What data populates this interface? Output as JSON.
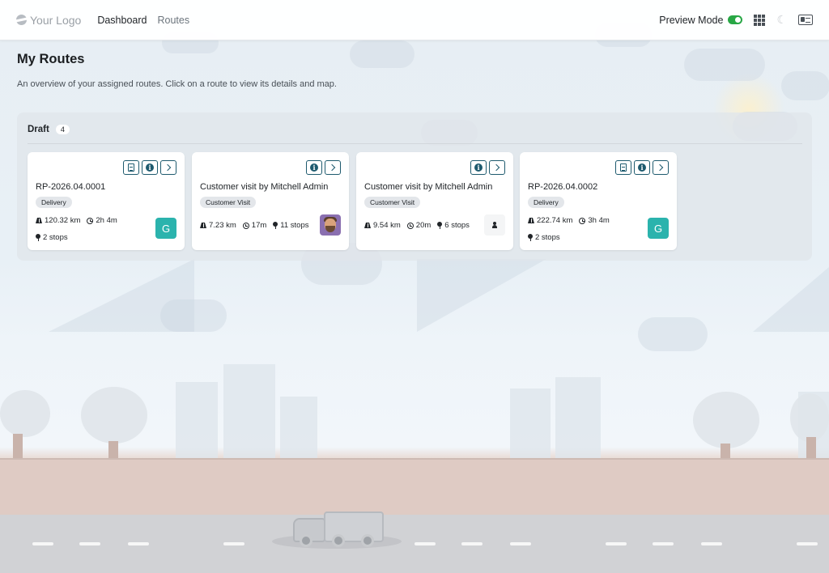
{
  "navbar": {
    "logo_text": "Your Logo",
    "links": [
      "Dashboard",
      "Routes"
    ],
    "preview_label": "Preview Mode",
    "preview_on": true
  },
  "page": {
    "title": "My Routes",
    "subtitle": "An overview of your assigned routes. Click on a route to view its details and map."
  },
  "group": {
    "title": "Draft",
    "count": "4"
  },
  "cards": [
    {
      "title": "RP-2026.04.0001",
      "badge": "Delivery",
      "distance": "120.32 km",
      "duration": "2h 4m",
      "stops": "2 stops",
      "avatar": "G",
      "buttons": [
        "doc-icon",
        "info-icon",
        "chevron-right-icon"
      ]
    },
    {
      "title": "Customer visit by Mitchell Admin",
      "badge": "Customer Visit",
      "distance": "7.23 km",
      "duration": "17m",
      "stops": "11 stops",
      "avatar": "photo",
      "buttons": [
        "info-icon",
        "chevron-right-icon"
      ]
    },
    {
      "title": "Customer visit by Mitchell Admin",
      "badge": "Customer Visit",
      "distance": "9.54 km",
      "duration": "20m",
      "stops": "6 stops",
      "avatar": "person-icon",
      "buttons": [
        "info-icon",
        "chevron-right-icon"
      ]
    },
    {
      "title": "RP-2026.04.0002",
      "badge": "Delivery",
      "distance": "222.74 km",
      "duration": "3h 4m",
      "stops": "2 stops",
      "avatar": "G",
      "buttons": [
        "doc-icon",
        "info-icon",
        "chevron-right-icon"
      ]
    }
  ],
  "colors": {
    "accent": "#1e5a6e",
    "avatar": "#2bb3ad",
    "toggle_on": "#28a745"
  }
}
